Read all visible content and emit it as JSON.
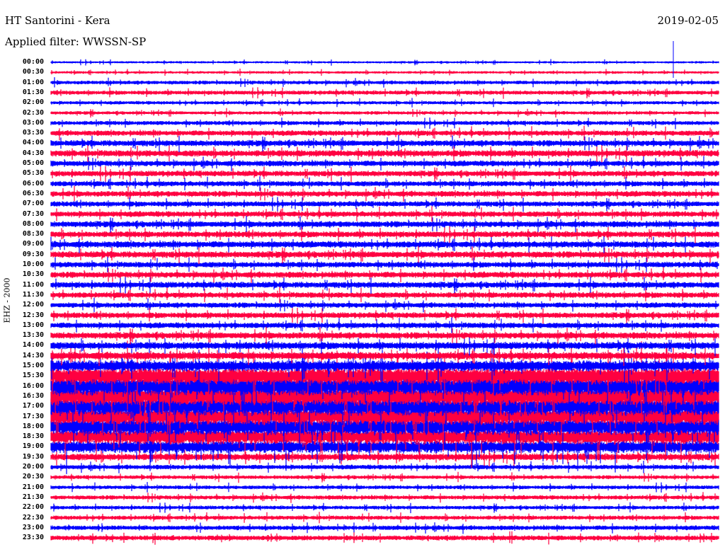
{
  "header": {
    "title": "HT Santorini - Kera",
    "filter": "Applied filter: WWSSN-SP",
    "date": "2019-02-05"
  },
  "chart_data": {
    "type": "line",
    "title": "HT Santorini - Kera",
    "subtitle": "Applied filter: WWSSN-SP",
    "date": "2019-02-05",
    "ylabel": "EHZ - 2000",
    "xlabel": "",
    "colors": [
      "#0000ff",
      "#ff0040"
    ],
    "row_labels": [
      "00:00",
      "00:30",
      "01:00",
      "01:30",
      "02:00",
      "02:30",
      "03:00",
      "03:30",
      "04:00",
      "04:30",
      "05:00",
      "05:30",
      "06:00",
      "06:30",
      "07:00",
      "07:30",
      "08:00",
      "08:30",
      "09:00",
      "09:30",
      "10:00",
      "10:30",
      "11:00",
      "11:30",
      "12:00",
      "12:30",
      "13:00",
      "13:30",
      "14:00",
      "14:30",
      "15:00",
      "15:30",
      "16:00",
      "16:30",
      "17:00",
      "17:30",
      "18:00",
      "18:30",
      "19:00",
      "19:30",
      "20:00",
      "20:30",
      "21:00",
      "21:30",
      "22:00",
      "22:30",
      "23:00",
      "23:30"
    ],
    "relative_amplitude": [
      0.3,
      0.35,
      0.5,
      0.55,
      0.45,
      0.45,
      0.55,
      0.7,
      0.8,
      0.85,
      0.75,
      0.75,
      0.7,
      0.75,
      0.7,
      0.75,
      0.8,
      0.8,
      0.85,
      0.85,
      0.75,
      0.8,
      0.8,
      0.75,
      0.7,
      0.75,
      0.75,
      0.85,
      0.95,
      1.0,
      1.4,
      2.2,
      2.4,
      2.4,
      2.4,
      2.2,
      2.2,
      2.0,
      1.6,
      0.9,
      0.6,
      0.5,
      0.5,
      0.55,
      0.5,
      0.55,
      0.6,
      0.65
    ]
  }
}
